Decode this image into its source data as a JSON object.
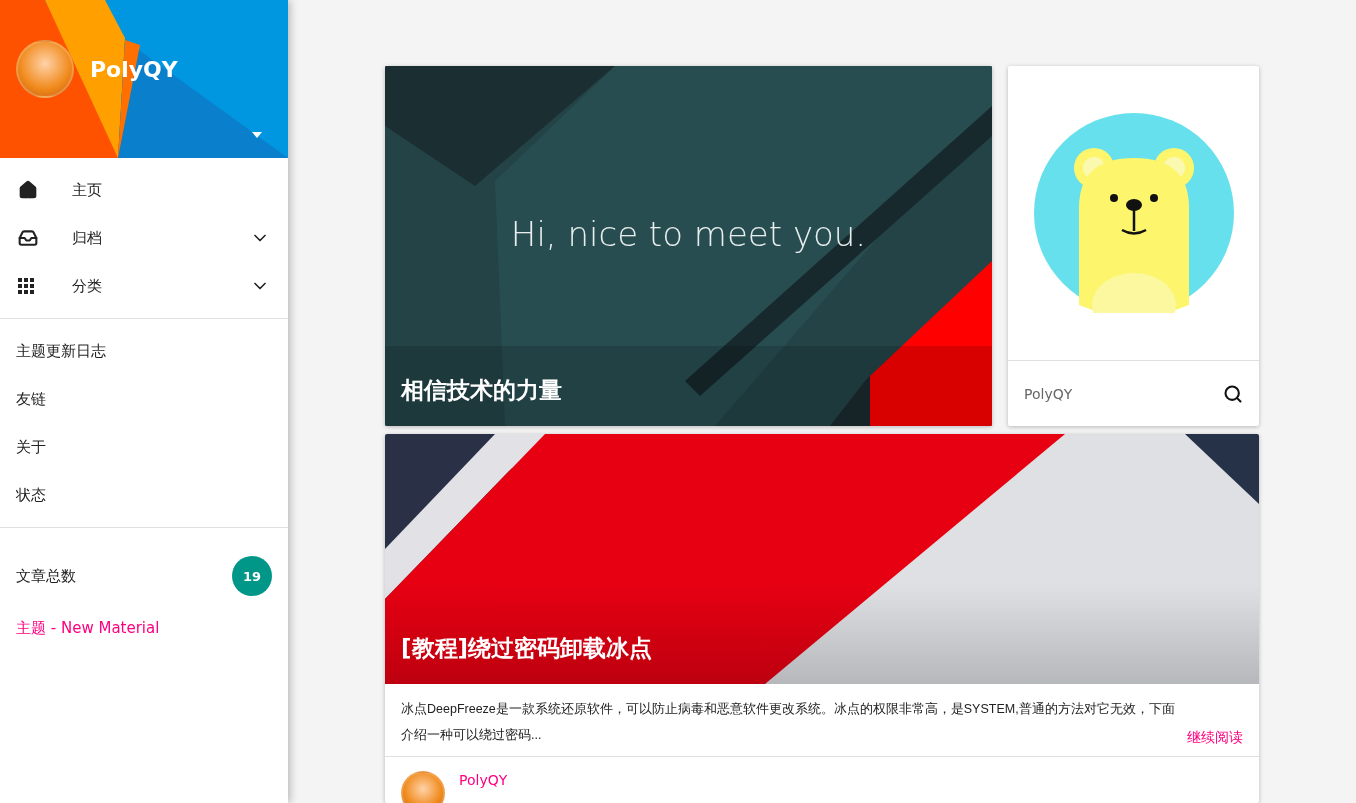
{
  "sidebar": {
    "header": {
      "name": "PolyQY"
    },
    "nav": [
      {
        "kind": "link",
        "label": "主页"
      },
      {
        "kind": "expandable",
        "label": "归档",
        "expanded": false
      },
      {
        "kind": "expandable",
        "label": "分类",
        "expanded": false
      }
    ],
    "pages": [
      "主题更新日志",
      "友链",
      "关于",
      "状态"
    ],
    "stats": {
      "label": "文章总数",
      "count": "19"
    },
    "theme": "主题 - New Material"
  },
  "hero": {
    "tagline": "Hi, nice to meet you.",
    "title": "相信技术的力量"
  },
  "profile": {
    "name": "PolyQY"
  },
  "post": {
    "title": "[教程]绕过密码卸载冰点",
    "excerpt": "冰点DeepFreeze是一款系统还原软件，可以防止病毒和恶意软件更改系统。冰点的权限非常高，是SYSTEM,普通的方法对它无效，下面介绍一种可以绕过密码...",
    "read_more": "继续阅读",
    "author": "PolyQY"
  }
}
